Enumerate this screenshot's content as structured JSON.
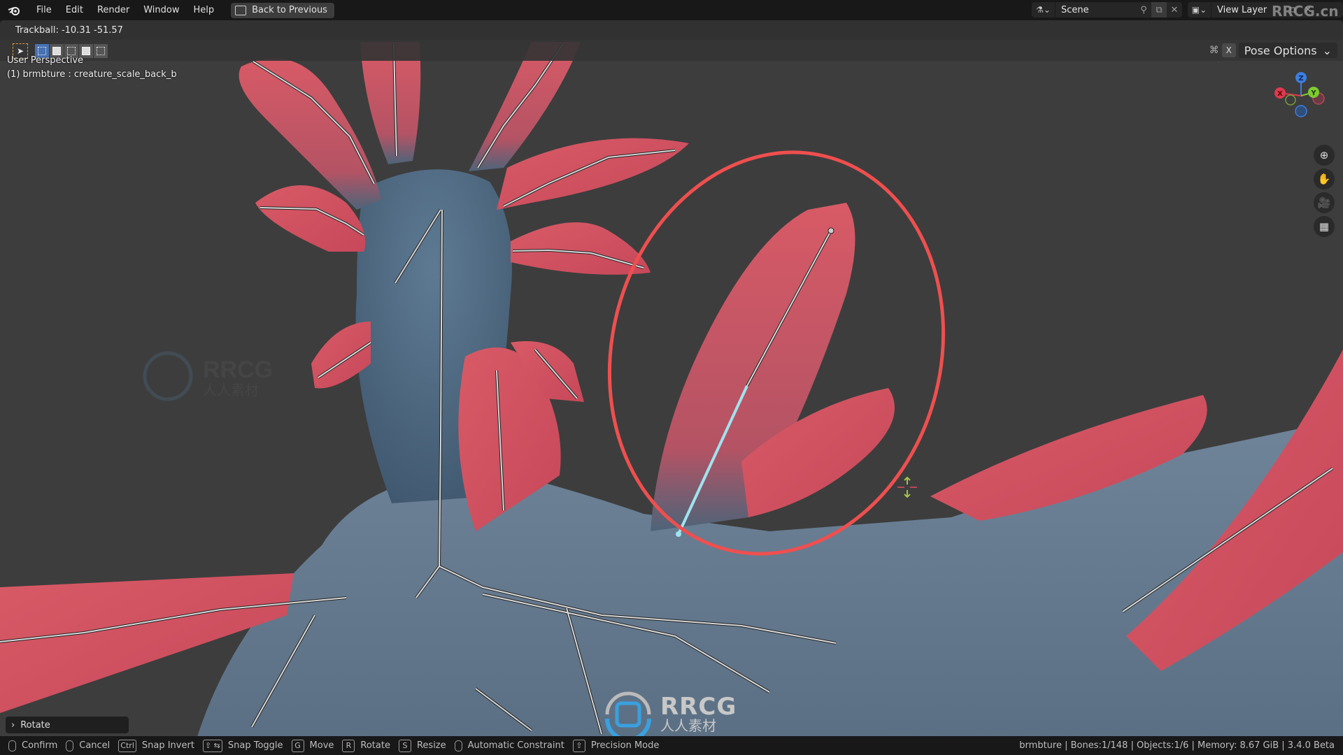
{
  "topbar": {
    "menu": [
      "File",
      "Edit",
      "Render",
      "Window",
      "Help"
    ],
    "back_button": "Back to Previous",
    "scene_name": "Scene",
    "view_layer": "View Layer",
    "watermark": "RRCG.cn"
  },
  "viewport": {
    "trackball": "Trackball: -10.31 -51.57",
    "pose_options": "Pose Options",
    "x_label": "X",
    "perspective": "User Perspective",
    "active_object": "(1) brmbture : creature_scale_back_b",
    "gizmo": {
      "x": "X",
      "y": "Y",
      "z": "Z",
      "colors": {
        "x": "#e0394f",
        "y": "#7ec932",
        "z": "#3d7ee0"
      }
    },
    "highlight_color": "#ef4f4f",
    "selected_bone_color": "#9fe3ee",
    "last_operation": "Rotate",
    "watermark_big": "RRCG",
    "watermark_small": "人人素材"
  },
  "statusbar": {
    "items": [
      {
        "key": "mouse-left",
        "label": "Confirm"
      },
      {
        "key": "mouse-right",
        "label": "Cancel"
      },
      {
        "key": "Ctrl",
        "label": "Snap Invert"
      },
      {
        "key": "⇧ ⇆",
        "label": "Snap Toggle"
      },
      {
        "key": "G",
        "label": "Move"
      },
      {
        "key": "R",
        "label": "Rotate"
      },
      {
        "key": "S",
        "label": "Resize"
      },
      {
        "key": "mouse-middle",
        "label": "Automatic Constraint"
      },
      {
        "key": "⇧",
        "label": "Precision Mode"
      }
    ],
    "stats": "brmbture | Bones:1/148 | Objects:1/6 | Memory: 8.67 GiB | 3.4.0 Beta"
  }
}
